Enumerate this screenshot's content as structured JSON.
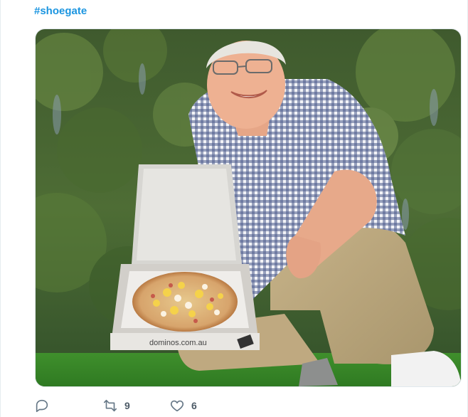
{
  "tweet": {
    "hashtag": "#shoegate",
    "pizza_box_print": "dominos.com.au"
  },
  "actions": {
    "reply": {
      "icon": "reply-icon"
    },
    "retweet": {
      "icon": "retweet-icon",
      "count": "9"
    },
    "like": {
      "icon": "heart-icon",
      "count": "6"
    }
  },
  "colors": {
    "link": "#1b95e0",
    "action_icon": "#657786"
  }
}
